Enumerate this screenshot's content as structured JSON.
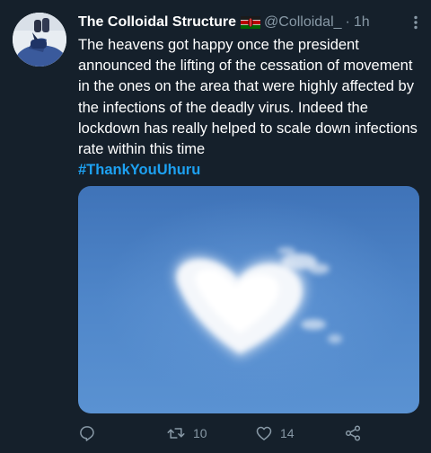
{
  "tweet": {
    "author": {
      "display_name": "The Colloidal Structure",
      "handle": "@Colloidal_",
      "flag_icon": "kenya-flag-icon"
    },
    "separator": "·",
    "time": "1h",
    "text": "The heavens got happy once the president announced the lifting of the cessation of movement in the ones on the area that were highly affected by the infections of the deadly virus. Indeed the lockdown has really helped to scale down infections rate within this time",
    "hashtag": "#ThankYouUhuru",
    "image_description_icon": "heart-shaped-cloud-image",
    "actions": {
      "reply_count": "",
      "retweet_count": "10",
      "like_count": "14"
    }
  },
  "colors": {
    "background": "#15202b",
    "text": "#ffffff",
    "secondary": "#8899a6",
    "link": "#1da1f2"
  }
}
